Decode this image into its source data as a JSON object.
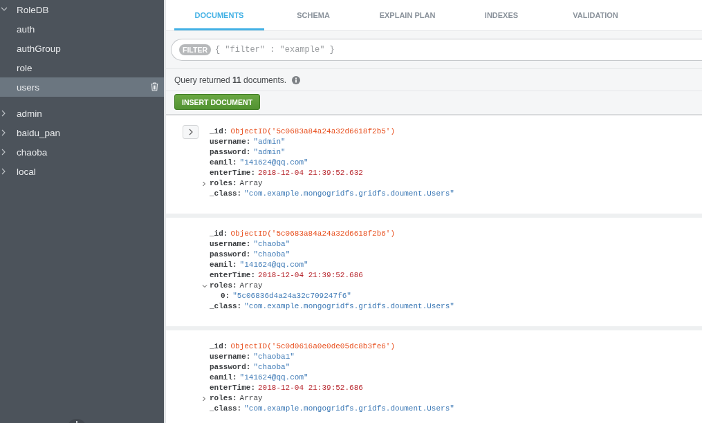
{
  "sidebar": {
    "databases": [
      {
        "name": "RoleDB",
        "expanded": true,
        "collections": [
          {
            "name": "auth",
            "selected": false
          },
          {
            "name": "authGroup",
            "selected": false
          },
          {
            "name": "role",
            "selected": false
          },
          {
            "name": "users",
            "selected": true
          }
        ]
      },
      {
        "name": "admin",
        "expanded": false
      },
      {
        "name": "baidu_pan",
        "expanded": false
      },
      {
        "name": "chaoba",
        "expanded": false
      },
      {
        "name": "local",
        "expanded": false
      }
    ]
  },
  "tabs": [
    {
      "label": "DOCUMENTS",
      "selected": true
    },
    {
      "label": "SCHEMA",
      "selected": false
    },
    {
      "label": "EXPLAIN PLAN",
      "selected": false
    },
    {
      "label": "INDEXES",
      "selected": false
    },
    {
      "label": "VALIDATION",
      "selected": false
    }
  ],
  "filter": {
    "label": "FILTER",
    "placeholder": "{ \"filter\" : \"example\" }"
  },
  "query_summary": "Query returned **11** documents.",
  "insert_button": "INSERT DOCUMENT",
  "documents": [
    {
      "show_expand_button": true,
      "fields": [
        {
          "key": "_id:",
          "kind": "objectid",
          "value": "ObjectID('5c0683a84a24a32d6618f2b5')"
        },
        {
          "key": "username:",
          "kind": "string",
          "value": "\"admin\""
        },
        {
          "key": "password:",
          "kind": "string",
          "value": "\"admin\""
        },
        {
          "key": "eamil:",
          "kind": "string",
          "value": "\"141624@qq.com\""
        },
        {
          "key": "enterTime:",
          "kind": "date",
          "value": "2018-12-04 21:39:52.632"
        },
        {
          "key": "roles:",
          "kind": "array",
          "value": "Array",
          "expanded": false
        },
        {
          "key": "_class:",
          "kind": "string",
          "value": "\"com.example.mongogridfs.gridfs.doument.Users\""
        }
      ]
    },
    {
      "show_expand_button": false,
      "fields": [
        {
          "key": "_id:",
          "kind": "objectid",
          "value": "ObjectID('5c0683a84a24a32d6618f2b6')"
        },
        {
          "key": "username:",
          "kind": "string",
          "value": "\"chaoba\""
        },
        {
          "key": "password:",
          "kind": "string",
          "value": "\"chaoba\""
        },
        {
          "key": "eamil:",
          "kind": "string",
          "value": "\"141624@qq.com\""
        },
        {
          "key": "enterTime:",
          "kind": "date",
          "value": "2018-12-04 21:39:52.686"
        },
        {
          "key": "roles:",
          "kind": "array",
          "value": "Array",
          "expanded": true,
          "children": [
            {
              "key": "0:",
              "kind": "string",
              "value": "\"5c06836d4a24a32c709247f6\""
            }
          ]
        },
        {
          "key": "_class:",
          "kind": "string",
          "value": "\"com.example.mongogridfs.gridfs.doument.Users\""
        }
      ]
    },
    {
      "show_expand_button": false,
      "fields": [
        {
          "key": "_id:",
          "kind": "objectid",
          "value": "ObjectID('5c0d0616a0e0de05dc8b3fe6')"
        },
        {
          "key": "username:",
          "kind": "string",
          "value": "\"chaoba1\""
        },
        {
          "key": "password:",
          "kind": "string",
          "value": "\"chaoba\""
        },
        {
          "key": "eamil:",
          "kind": "string",
          "value": "\"141624@qq.com\""
        },
        {
          "key": "enterTime:",
          "kind": "date",
          "value": "2018-12-04 21:39:52.686"
        },
        {
          "key": "roles:",
          "kind": "array",
          "value": "Array",
          "expanded": false
        },
        {
          "key": "_class:",
          "kind": "string",
          "value": "\"com.example.mongogridfs.gridfs.doument.Users\""
        }
      ]
    }
  ]
}
